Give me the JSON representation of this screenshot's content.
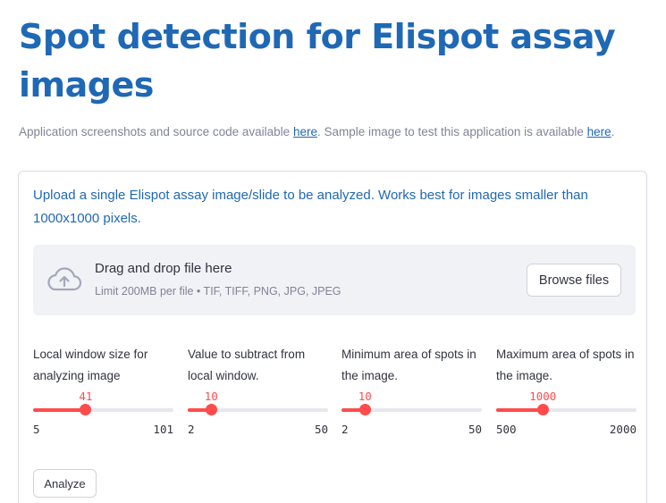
{
  "title": "Spot detection for Elispot assay images",
  "subline": {
    "text_before_link1": "Application screenshots and source code available ",
    "link1": "here",
    "text_between": ". Sample image to test this application is available ",
    "link2": "here",
    "text_after": "."
  },
  "form": {
    "info": "Upload a single Elispot assay image/slide to be analyzed. Works best for images smaller than 1000x1000 pixels.",
    "uploader": {
      "icon": "cloud-upload-icon",
      "drop_text": "Drag and drop file here",
      "limit_text": "Limit 200MB per file • TIF, TIFF, PNG, JPG, JPEG",
      "browse_label": "Browse files"
    },
    "sliders": [
      {
        "label": "Local window size for analyzing image",
        "value": "41",
        "min": "5",
        "max": "101",
        "fraction": 0.375
      },
      {
        "label": "Value to subtract from local window.",
        "value": "10",
        "min": "2",
        "max": "50",
        "fraction": 0.167
      },
      {
        "label": "Minimum area of spots in the image.",
        "value": "10",
        "min": "2",
        "max": "50",
        "fraction": 0.167
      },
      {
        "label": "Maximum area of spots in the image.",
        "value": "1000",
        "min": "500",
        "max": "2000",
        "fraction": 0.333
      }
    ],
    "analyze_label": "Analyze"
  },
  "colors": {
    "primary_blue": "#1f68b5",
    "slider_red": "#ff4b4b",
    "uploader_bg": "#f0f2f6",
    "muted_text": "#808495"
  }
}
